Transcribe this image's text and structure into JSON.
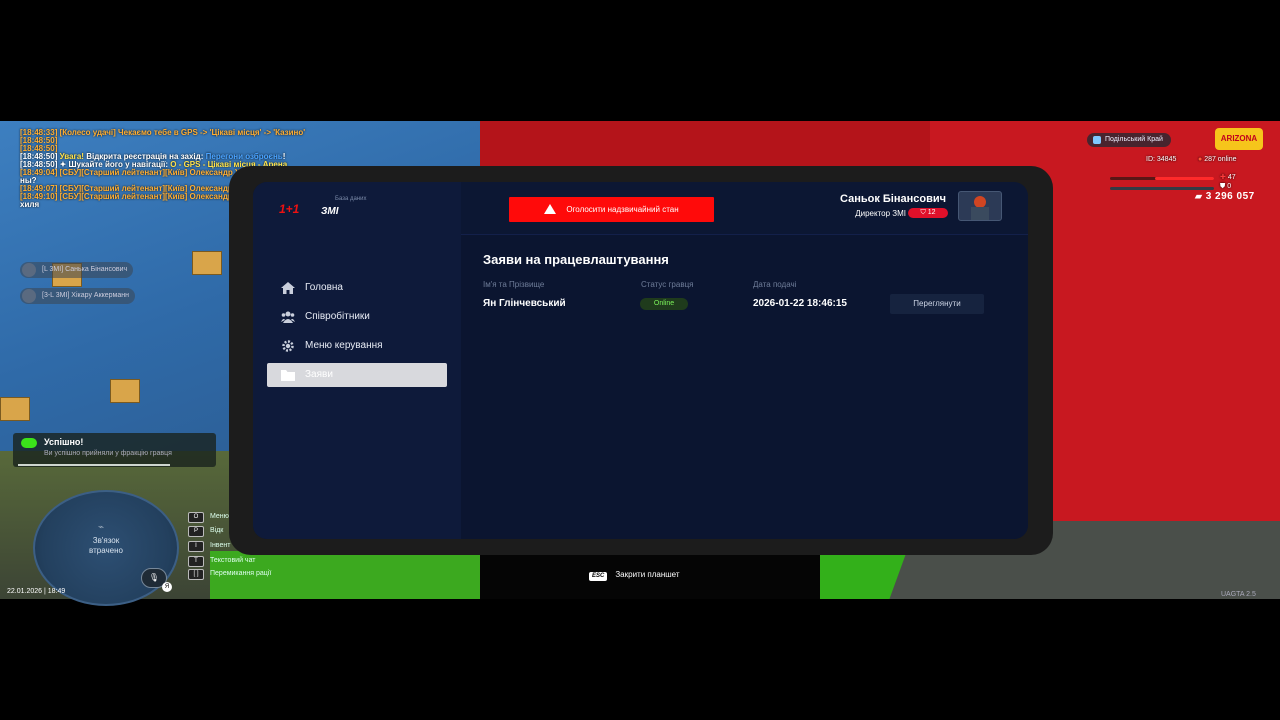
{
  "chat": [
    {
      "parts": [
        {
          "t": "[18:48:33] [Колесо удачі] Чекаємо тебе в GPS -> 'Цікаві місця' -> 'Казино'",
          "c": "c-o"
        }
      ]
    },
    {
      "parts": [
        {
          "t": "[18:48:50]",
          "c": "c-o"
        }
      ]
    },
    {
      "parts": [
        {
          "t": "[18:48:50]",
          "c": "c-o"
        }
      ]
    },
    {
      "parts": [
        {
          "t": "[18:48:50] ",
          "c": "c-w"
        },
        {
          "t": "Увага! ",
          "c": "c-y"
        },
        {
          "t": "Відкрита реєстрація на захід: ",
          "c": "c-w"
        },
        {
          "t": "Перегони озброєнь",
          "c": "c-b"
        },
        {
          "t": "!",
          "c": "c-w"
        }
      ]
    },
    {
      "parts": [
        {
          "t": "[18:48:50]  ✦  Шукайте його у навігації: ",
          "c": "c-w"
        },
        {
          "t": "O - GPS - Цікаві місця - Арена",
          "c": "c-y"
        }
      ]
    },
    {
      "parts": [
        {
          "t": "[18:49:04] [СБУ][Старший лейтенант][Київ] Олександр Усикович [36148]: ",
          "c": "c-o"
        },
        {
          "t": "дау",
          "c": "c-w"
        }
      ]
    },
    {
      "parts": [
        {
          "t": "ны?",
          "c": "c-w"
        }
      ]
    },
    {
      "parts": [
        {
          "t": "[18:49:07] [СБУ][Старший лейтенант][Київ] Олександр Усикович [36148]: ",
          "c": "c-o"
        },
        {
          "t": "кзм..",
          "c": "c-w"
        }
      ]
    },
    {
      "parts": [
        {
          "t": "[18:49:10] [СБУ][Старший лейтенант][Київ] Олександр Усикович [36148]: ",
          "c": "c-o"
        },
        {
          "t": "не та",
          "c": "c-w"
        }
      ]
    },
    {
      "parts": [
        {
          "t": "хиля",
          "c": "c-w"
        }
      ]
    }
  ],
  "tags": [
    "[L 3МІ] Санька Бінансович",
    "[3-L 3МІ] Хікару Аккерманн"
  ],
  "notification": {
    "title": "Успішно!",
    "text": "Ви успішно прийняли у фракцію гравця"
  },
  "radar": {
    "line1": "Зв'язок",
    "line2": "втрачено",
    "mic_badge": "Я"
  },
  "datetime": "22.01.2026 | 18:49",
  "hotkeys": [
    {
      "key": "O",
      "label": "Меню"
    },
    {
      "key": "P",
      "label": "Відк"
    },
    {
      "key": "I",
      "label": "Інвент"
    },
    {
      "key": "T",
      "label": "Текстовий чат"
    },
    {
      "key": "[ ]",
      "label": "Перемикання рації"
    }
  ],
  "hud": {
    "region": "Подільський Край",
    "logo": "ARIZONA",
    "id_label": "ID: 34845",
    "online": "287 online",
    "health": "47",
    "armor": "0",
    "money": "3 296 057",
    "version": "UAGTA 2.5"
  },
  "tablet": {
    "brand_a": "1+1",
    "brand_b": "ЗМІ",
    "brand_c": "База даних",
    "alarm_button": "Оголосити надзвичайний стан",
    "user_name": "Саньок Бінансович",
    "user_role": "Директор ЗМІ",
    "user_level": "12",
    "nav": [
      {
        "label": "Головна",
        "icon": "home-icon"
      },
      {
        "label": "Співробітники",
        "icon": "users-icon"
      },
      {
        "label": "Меню керування",
        "icon": "gear-icon"
      },
      {
        "label": "Заяви",
        "icon": "folder-icon",
        "active": true
      }
    ],
    "section_title": "Заяви на працевлаштування",
    "columns": [
      "Ім'я та Прізвище",
      "Статус гравця",
      "Дата подачі"
    ],
    "rows": [
      {
        "name": "Ян Глінчевський",
        "status": "Online",
        "date": "2026-01-22 18:46:15",
        "action": "Переглянути"
      }
    ]
  },
  "esc": {
    "key": "ESC",
    "label": "Закрити планшет"
  },
  "colors": {
    "accent": "#ff0a0a",
    "panel": "#0c1733",
    "status_online": "#7bf25a"
  }
}
